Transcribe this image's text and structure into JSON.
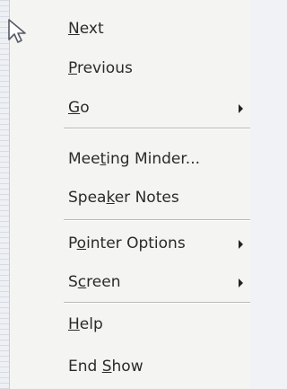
{
  "menu": {
    "items": [
      {
        "pre": "",
        "mn": "N",
        "post": "ext"
      },
      {
        "pre": "",
        "mn": "P",
        "post": "revious"
      },
      {
        "pre": "",
        "mn": "G",
        "post": "o"
      },
      {
        "pre": "Mee",
        "mn": "t",
        "post": "ing Minder..."
      },
      {
        "pre": "Spea",
        "mn": "k",
        "post": "er Notes"
      },
      {
        "pre": "P",
        "mn": "o",
        "post": "inter Options"
      },
      {
        "pre": "S",
        "mn": "c",
        "post": "reen"
      },
      {
        "pre": "",
        "mn": "H",
        "post": "elp"
      },
      {
        "pre": "End ",
        "mn": "S",
        "post": "how"
      }
    ],
    "submenu_arrow_icon": "triangle-right-icon"
  },
  "cursor_icon": "mouse-pointer-icon"
}
